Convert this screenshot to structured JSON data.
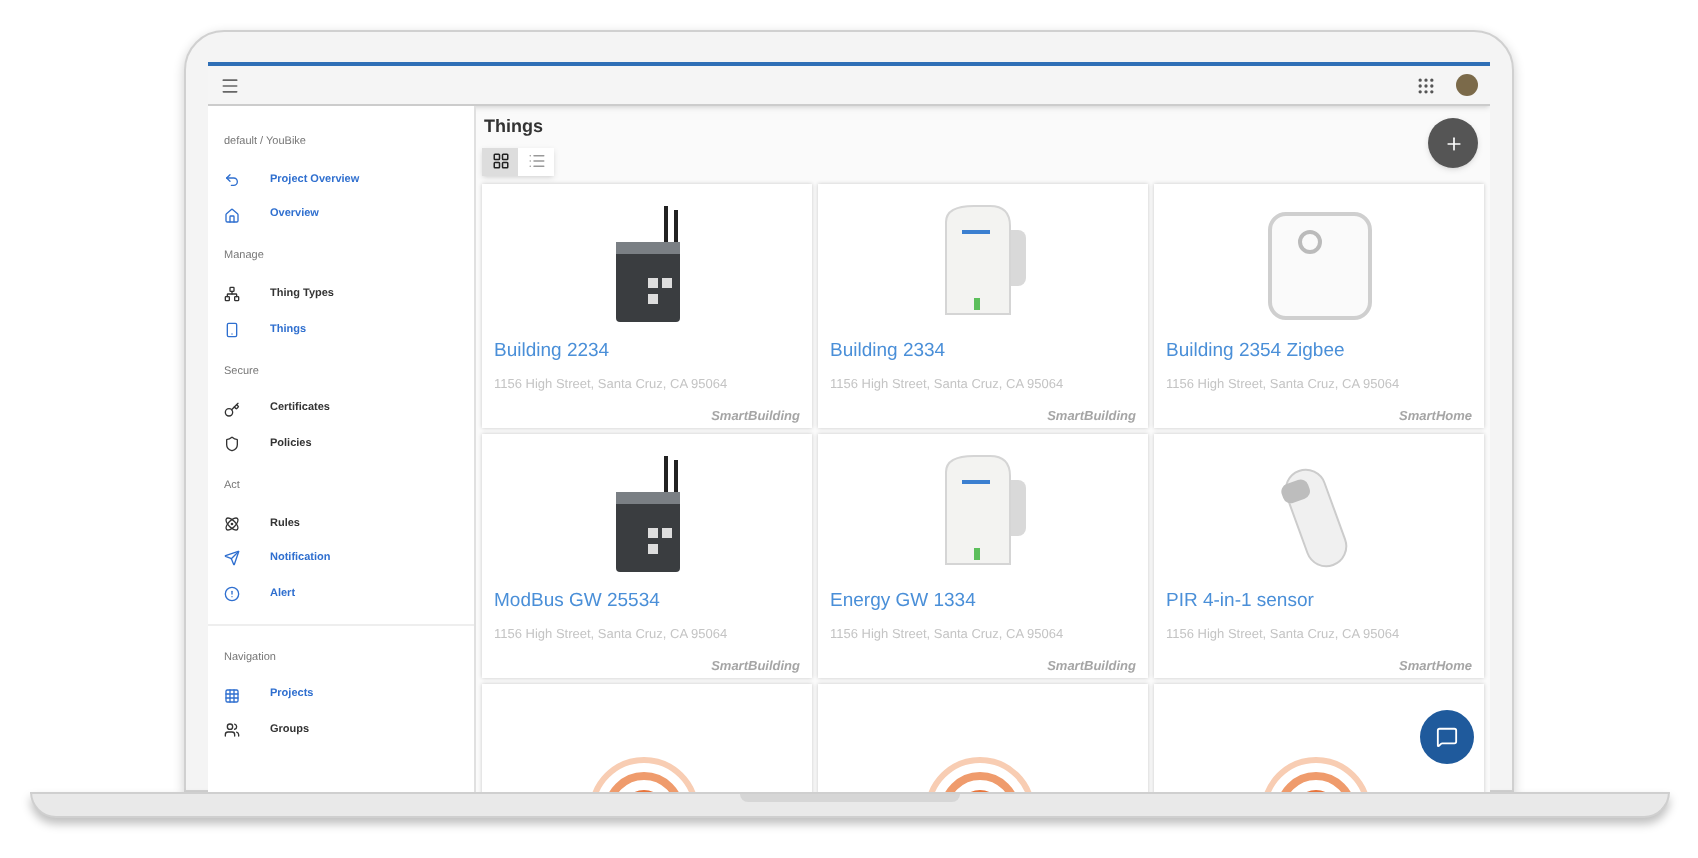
{
  "sidebar": {
    "project": "default / YouBike",
    "sections": [
      {
        "items": [
          {
            "label": "Project Overview",
            "accent": true
          },
          {
            "label": "Overview",
            "accent": true
          }
        ]
      },
      {
        "title": "Manage",
        "items": [
          {
            "label": "Thing Types",
            "accent": false
          },
          {
            "label": "Things",
            "accent": true
          }
        ]
      },
      {
        "title": "Secure",
        "items": [
          {
            "label": "Certificates",
            "accent": false
          },
          {
            "label": "Policies",
            "accent": false
          }
        ]
      },
      {
        "title": "Act",
        "items": [
          {
            "label": "Rules",
            "accent": false
          },
          {
            "label": "Notification",
            "accent": true
          },
          {
            "label": "Alert",
            "accent": true
          }
        ]
      },
      {
        "title": "Navigation",
        "items": [
          {
            "label": "Projects",
            "accent": true
          },
          {
            "label": "Groups",
            "accent": false
          }
        ]
      }
    ]
  },
  "main": {
    "title": "Things",
    "views": [
      {
        "kind": "grid",
        "selected": true
      },
      {
        "kind": "list",
        "selected": false
      }
    ],
    "cards": [
      {
        "kind": "gateway",
        "name": "Building 2234",
        "address": "1156 High Street, Santa Cruz, CA 95064",
        "tag": "SmartBuilding"
      },
      {
        "kind": "extender",
        "name": "Building 2334",
        "address": "1156 High Street, Santa Cruz, CA 95064",
        "tag": "SmartBuilding"
      },
      {
        "kind": "hub",
        "name": "Building 2354 Zigbee",
        "address": "1156 High Street, Santa Cruz, CA 95064",
        "tag": "SmartHome"
      },
      {
        "kind": "gateway",
        "name": "ModBus GW 25534",
        "address": "1156 High Street, Santa Cruz, CA 95064",
        "tag": "SmartBuilding"
      },
      {
        "kind": "extender",
        "name": "Energy GW 1334",
        "address": "1156 High Street, Santa Cruz, CA 95064",
        "tag": "SmartBuilding"
      },
      {
        "kind": "sensor",
        "name": "PIR 4-in-1 sensor",
        "address": "1156 High Street, Santa Cruz, CA 95064",
        "tag": "SmartHome"
      },
      {
        "kind": "beacon"
      },
      {
        "kind": "beacon"
      },
      {
        "kind": "beacon"
      }
    ]
  }
}
